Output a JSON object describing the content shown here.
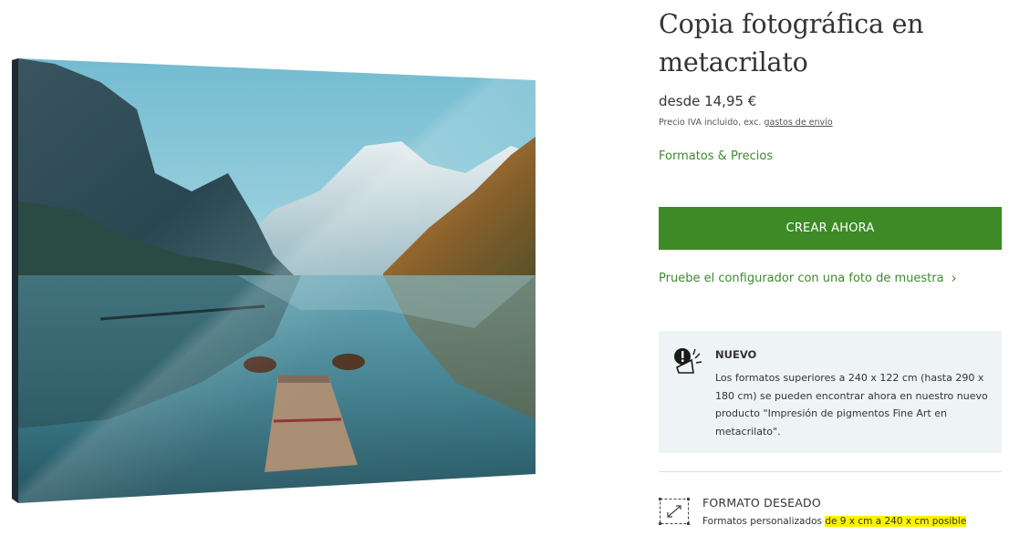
{
  "product": {
    "image_alt": "Lago con embarcadero de madera, dos barcas y montañas",
    "title": "Copia fotográfica en metacrilato",
    "price": "desde 14,95 €",
    "tax_note_prefix": "Precio IVA incluido, exc.",
    "shipping_link": "gastos de envío",
    "formats_link": "Formatos & Precios",
    "cta_label": "CREAR AHORA",
    "sample_link": "Pruebe el configurador con una foto de muestra",
    "sample_chevron": "›"
  },
  "notice": {
    "icon": "megaphone-alert-icon",
    "title": "NUEVO",
    "body": "Los formatos superiores a 240 x 122 cm (hasta 290 x 180 cm) se pueden encontrar ahora en nuestro nuevo producto \"Impresión de pigmentos Fine Art en metacrilato\"."
  },
  "format": {
    "icon": "resize-icon",
    "title": "FORMATO DESEADO",
    "subtitle_prefix": "Formatos personalizados",
    "subtitle_highlight": "de 9 x cm a 240 x cm posible"
  },
  "colors": {
    "accent_green": "#3d8a27",
    "link_green": "#3f8a2e",
    "notice_bg": "#eef3f6",
    "highlight": "#fff200"
  }
}
